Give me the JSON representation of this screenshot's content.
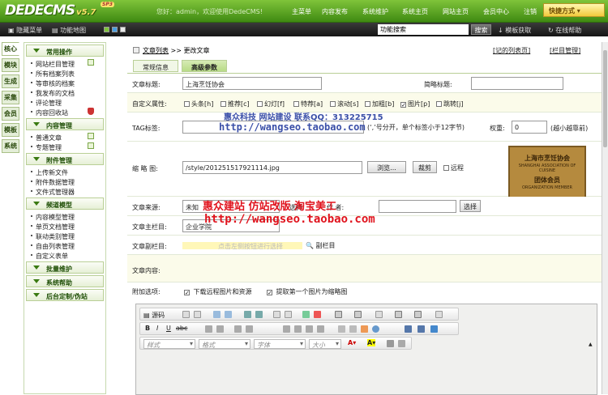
{
  "logo": {
    "name": "DEDECMS",
    "version": "v5.7",
    "badge": "SP3"
  },
  "header": {
    "welcome": "您好：admin，欢迎使用DedeCMS!",
    "nav": [
      "主菜单",
      "内容发布",
      "系统维护",
      "系统主页",
      "网站主页",
      "会员中心",
      "注销"
    ],
    "quick": "快捷方式"
  },
  "subbar": {
    "hide_menu": "隐藏菜单",
    "site_map": "功能地图",
    "search_placeholder": "功能搜索",
    "search_button": "搜索",
    "module_download": "模板获取",
    "online_help": "在线帮助"
  },
  "vtabs": [
    "核心",
    "模块",
    "生成",
    "采集",
    "会员",
    "模板",
    "系统"
  ],
  "sidebar": {
    "groups": [
      {
        "title": "常用操作",
        "items": [
          {
            "label": "网站栏目管理",
            "icon": "add"
          },
          {
            "label": "所有档案列表"
          },
          {
            "label": "等审核的档案"
          },
          {
            "label": "我发布的文档"
          },
          {
            "label": "评论管理"
          },
          {
            "label": "内容回收站",
            "icon": "shield"
          }
        ]
      },
      {
        "title": "内容管理",
        "items": [
          {
            "label": "普通文章",
            "icon": "add"
          },
          {
            "label": "专题管理",
            "icon": "add"
          }
        ]
      },
      {
        "title": "附件管理",
        "items": [
          {
            "label": "上传新文件"
          },
          {
            "label": "附件数据管理"
          },
          {
            "label": "文件式管理器"
          }
        ]
      },
      {
        "title": "频道模型",
        "items": [
          {
            "label": "内容模型管理"
          },
          {
            "label": "单页文档管理"
          },
          {
            "label": "联动类别管理"
          },
          {
            "label": "自由列表管理"
          },
          {
            "label": "自定义表单"
          }
        ]
      },
      {
        "title": "批量维护",
        "items": []
      },
      {
        "title": "系统帮助",
        "items": []
      },
      {
        "title": "后台定制/伪站",
        "items": []
      }
    ]
  },
  "breadcrumb": {
    "list": "文章列表",
    "sep": ">>",
    "current": "更改文章",
    "recycle": "[记的列表页]",
    "column": "[栏目管理]"
  },
  "tabs": [
    "常规信息",
    "高级参数"
  ],
  "form": {
    "title_label": "文章标题:",
    "title_value": "上海烹饪协会",
    "short_label": "简略标题:",
    "attr_label": "自定义属性:",
    "attrs": [
      {
        "label": "头条[h]",
        "checked": false
      },
      {
        "label": "推荐[c]",
        "checked": false
      },
      {
        "label": "幻灯[f]",
        "checked": false
      },
      {
        "label": "特荐[a]",
        "checked": false
      },
      {
        "label": "滚动[s]",
        "checked": false
      },
      {
        "label": "加粗[b]",
        "checked": false
      },
      {
        "label": "图片[p]",
        "checked": true
      },
      {
        "label": "跳转[j]",
        "checked": false
      }
    ],
    "tag_label": "TAG标签:",
    "tag_hint": "(‘,’号分开，单个标签小于12字节)",
    "weight_label": "权重:",
    "weight_value": "0",
    "weight_hint": "(越小越靠前)",
    "thumb_label": "缩 略 图:",
    "thumb_value": "/style/201251517921114.jpg",
    "browse": "浏览...",
    "crop": "裁剪",
    "remote": "远程",
    "source_label": "文章来源:",
    "source_value": "未知",
    "select_label": "选择",
    "author_label": "作 者:",
    "author_select": "选择",
    "main_col_label": "文章主栏目:",
    "main_col_value": "企业学院",
    "sub_col_label": "文章副栏目:",
    "sub_col_hint": "点击左侧按钮进行选择",
    "sub_col_btn": "副栏目",
    "content_label": "文章内容:",
    "options_label": "附加选项:",
    "opt1": "下载远程图片和资源",
    "opt2": "提取第一个图片为缩略图"
  },
  "stamp": {
    "line1": "上海市烹饪协会",
    "line2": "SHANGHAI ASSOCIATION OF CUISINE",
    "line3": "团体会员",
    "line4": "ORGANIZATION MEMBER"
  },
  "editor": {
    "source": "源码",
    "style_ph": "样式",
    "format_ph": "格式",
    "font_ph": "字体",
    "size_ph": "大小"
  },
  "watermarks": {
    "wm1": "惠众科技  网站建设  联系QQ：313225715",
    "wm2": "http://wangseo.taobao.com",
    "wm3": "惠众建站  仿站改版  淘宝美工",
    "wm4": "http://wangseo.taobao.com"
  },
  "colors": {
    "green": "#5aa620",
    "wm_red": "#e0131d"
  }
}
